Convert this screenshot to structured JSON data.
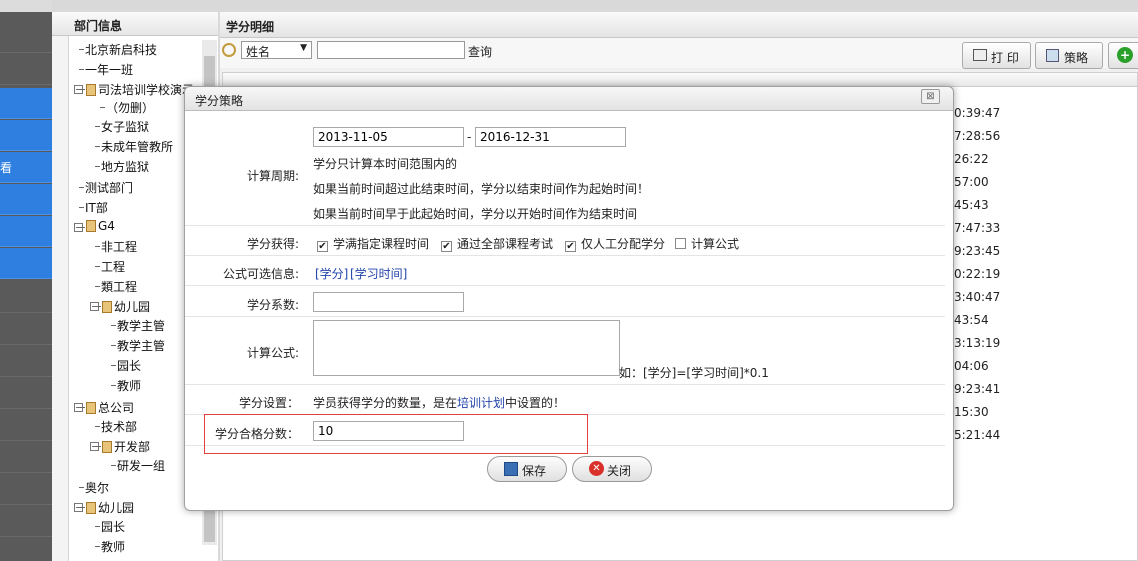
{
  "left_nav": {
    "partial_label": "看"
  },
  "dept_panel": {
    "title": "部门信息",
    "tree": [
      "北京新启科技",
      "一年一班",
      "司法培训学校演示",
      "（勿删）",
      "女子监狱",
      "未成年管教所",
      "地方监狱",
      "测试部门",
      "IT部",
      "G4",
      "非工程",
      "工程",
      "類工程",
      "幼儿园",
      "教学主管",
      "教学主管",
      "园长",
      "教师",
      "总公司",
      "技术部",
      "开发部",
      "研发一组",
      "奥尔",
      "幼儿园",
      "园长",
      "教师"
    ]
  },
  "main_panel": {
    "title": "学分明细",
    "search_field_selected": "姓名",
    "search_value": "",
    "query_label": "查询",
    "print_label": "打 印",
    "strategy_label": "策略",
    "times": [
      "0:39:47",
      "7:28:56",
      "26:22",
      "57:00",
      "45:43",
      "7:47:33",
      "9:23:45",
      "0:22:19",
      "3:40:47",
      "43:54",
      "3:13:19",
      "04:06",
      "9:23:41",
      "15:30",
      "5:21:44"
    ]
  },
  "modal": {
    "title": "学分策略",
    "close_glyph": "⊠",
    "period_label": "计算周期:",
    "start_date": "2013-11-05",
    "separator": "-",
    "end_date": "2016-12-31",
    "period_notes": [
      "学分只计算本时间范围内的",
      "如果当前时间超过此结束时间，学分以结束时间作为起始时间！",
      "如果当前时间早于此起始时间，学分以开始时间作为结束时间"
    ],
    "acquire_label": "学分获得:",
    "options": [
      {
        "label": "学满指定课程时间",
        "checked": true
      },
      {
        "label": "通过全部课程考试",
        "checked": true
      },
      {
        "label": "仅人工分配学分",
        "checked": true
      },
      {
        "label": "计算公式",
        "checked": false
      }
    ],
    "formula_info_label": "公式可选信息:",
    "formula_tokens": [
      "[学分]",
      "[学习时间]"
    ],
    "coefficient_label": "学分系数:",
    "coefficient_value": "",
    "formula_label": "计算公式:",
    "formula_value": "",
    "formula_example": "如：[学分]=[学习时间]*0.1",
    "setting_label": "学分设置：",
    "setting_text_before": "学员获得学分的数量，是在",
    "setting_link": "培训计划",
    "setting_text_after": "中设置的！",
    "pass_label": "学分合格分数：",
    "pass_value": "10",
    "save_label": "保存",
    "close_label": "关闭"
  },
  "colors": {
    "accent_blue": "#2f7fe0",
    "highlight_red": "#e04040"
  }
}
